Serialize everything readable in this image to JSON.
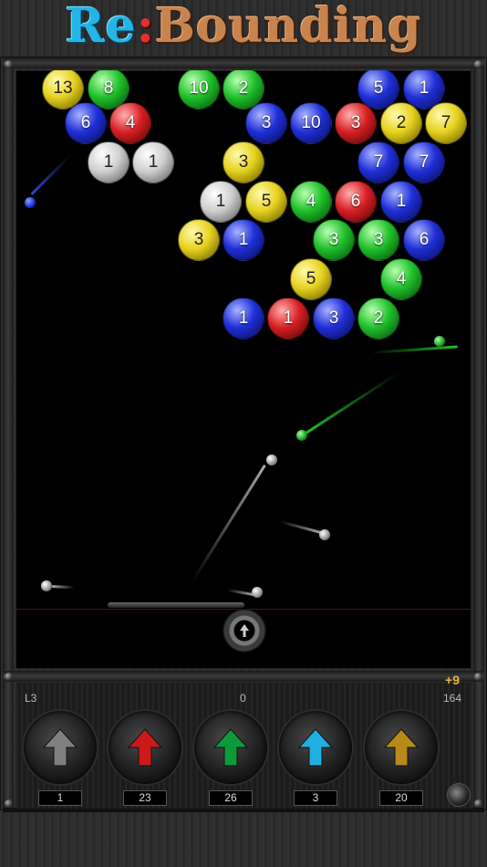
{
  "title": {
    "part1": "Re",
    "colon": ":",
    "part2": "Bounding"
  },
  "colors": {
    "yellow": "#e6d21f",
    "green": "#1fc12a",
    "blue": "#1f2fd8",
    "red": "#d81f24",
    "gray": "#d0d0d0",
    "cyan": "#22b5e6",
    "orange": "#c9834d"
  },
  "bubbles": [
    {
      "n": "13",
      "c": "yellow"
    },
    {
      "n": "8",
      "c": "green"
    },
    {
      "n": "10",
      "c": "green"
    },
    {
      "n": "2",
      "c": "green"
    },
    {
      "n": "5",
      "c": "blue"
    },
    {
      "n": "1",
      "c": "blue"
    },
    {
      "n": "6",
      "c": "blue"
    },
    {
      "n": "4",
      "c": "red"
    },
    {
      "n": "3",
      "c": "blue"
    },
    {
      "n": "10",
      "c": "blue"
    },
    {
      "n": "3",
      "c": "red"
    },
    {
      "n": "2",
      "c": "yellow"
    },
    {
      "n": "7",
      "c": "yellow"
    },
    {
      "n": "1",
      "c": "gray"
    },
    {
      "n": "1",
      "c": "gray"
    },
    {
      "n": "3",
      "c": "yellow"
    },
    {
      "n": "7",
      "c": "blue"
    },
    {
      "n": "7",
      "c": "blue"
    },
    {
      "n": "1",
      "c": "gray"
    },
    {
      "n": "5",
      "c": "yellow"
    },
    {
      "n": "4",
      "c": "green"
    },
    {
      "n": "6",
      "c": "red"
    },
    {
      "n": "1",
      "c": "blue"
    },
    {
      "n": "3",
      "c": "yellow"
    },
    {
      "n": "1",
      "c": "blue"
    },
    {
      "n": "3",
      "c": "green"
    },
    {
      "n": "3",
      "c": "green"
    },
    {
      "n": "6",
      "c": "blue"
    },
    {
      "n": "5",
      "c": "yellow"
    },
    {
      "n": "4",
      "c": "green"
    },
    {
      "n": "1",
      "c": "blue"
    },
    {
      "n": "1",
      "c": "red"
    },
    {
      "n": "3",
      "c": "blue"
    },
    {
      "n": "2",
      "c": "green"
    }
  ],
  "status": {
    "level": "L3",
    "center": "0",
    "right": "164",
    "bonus": "+9"
  },
  "powerups": [
    {
      "color": "gray",
      "hex": "#808080",
      "count": "1"
    },
    {
      "color": "red",
      "hex": "#cc1a1a",
      "count": "23"
    },
    {
      "color": "green",
      "hex": "#0e9a3a",
      "count": "26"
    },
    {
      "color": "cyan",
      "hex": "#1fb0e0",
      "count": "3"
    },
    {
      "color": "orange",
      "hex": "#b88a1a",
      "count": "20"
    }
  ],
  "icons": {
    "shooter": "shooter-icon",
    "settings": "settings-knob-icon",
    "arrow": "up-arrow-icon"
  }
}
